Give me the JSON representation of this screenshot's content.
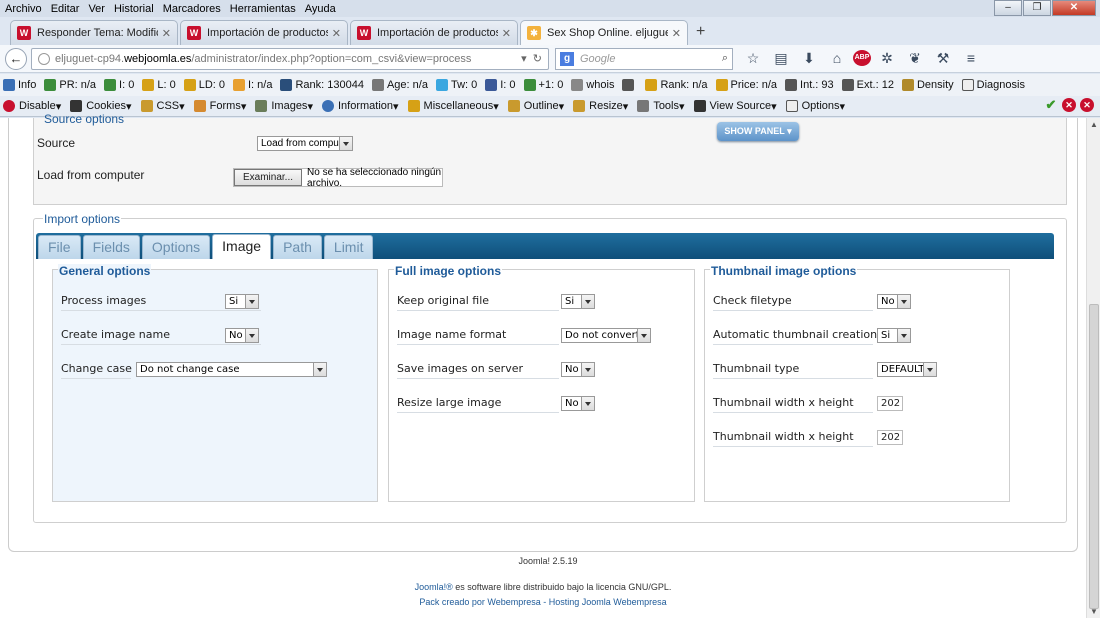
{
  "menubar": {
    "items": [
      "Archivo",
      "Editar",
      "Ver",
      "Historial",
      "Marcadores",
      "Herramientas",
      "Ayuda"
    ]
  },
  "browser_tabs": [
    {
      "title": "Responder Tema: Modifica...",
      "icon": "joomla-icon"
    },
    {
      "title": "Importación de productos ...",
      "icon": "joomla-icon"
    },
    {
      "title": "Importación de productos ...",
      "icon": "joomla-icon"
    },
    {
      "title": "Sex Shop Online. eljuguete...",
      "icon": "joomla-icon",
      "active": true
    }
  ],
  "urlbar": {
    "host_prefix": "eljuguet-cp94.",
    "host": "webjoomla.es",
    "path": "/administrator/index.php?option=com_csvi&view=process"
  },
  "searchbar": {
    "placeholder": "Google"
  },
  "seobar": {
    "items": [
      "Info",
      "PR: n/a",
      "I: 0",
      "L: 0",
      "LD: 0",
      "I: n/a",
      "Rank: 130044",
      "Age: n/a",
      "Tw: 0",
      "I: 0",
      "+1: 0",
      "whois",
      "Rank: n/a",
      "Price: n/a",
      "Int.: 93",
      "Ext.: 12",
      "Density",
      "Diagnosis"
    ]
  },
  "devbar": {
    "items": [
      "Disable",
      "Cookies",
      "CSS",
      "Forms",
      "Images",
      "Information",
      "Miscellaneous",
      "Outline",
      "Resize",
      "Tools",
      "View Source",
      "Options"
    ]
  },
  "source_options": {
    "legend": "Source options",
    "source_label": "Source",
    "source_value": "Load from computer",
    "load_label": "Load from computer",
    "browse_button": "Examinar...",
    "file_status": "No se ha seleccionado ningún archivo.",
    "show_panel": "SHOW PANEL"
  },
  "import_options": {
    "legend": "Import options",
    "tabs": [
      "File",
      "Fields",
      "Options",
      "Image",
      "Path",
      "Limit"
    ],
    "active_tab": "Image",
    "general": {
      "title": "General options",
      "process_images": {
        "label": "Process images",
        "value": "Si"
      },
      "create_image_name": {
        "label": "Create image name",
        "value": "No"
      },
      "change_case": {
        "label": "Change case",
        "value": "Do not change case"
      }
    },
    "full": {
      "title": "Full image options",
      "keep_original": {
        "label": "Keep original file",
        "value": "Si"
      },
      "name_format": {
        "label": "Image name format",
        "value": "Do not convert"
      },
      "save_on_server": {
        "label": "Save images on server",
        "value": "No"
      },
      "resize_large": {
        "label": "Resize large image",
        "value": "No"
      }
    },
    "thumbnail": {
      "title": "Thumbnail image options",
      "check_filetype": {
        "label": "Check filetype",
        "value": "No"
      },
      "auto_creation": {
        "label": "Automatic thumbnail creation",
        "value": "Si"
      },
      "type": {
        "label": "Thumbnail type",
        "value": "DEFAULT"
      },
      "width": {
        "label": "Thumbnail width x height",
        "value": "202"
      },
      "height": {
        "label": "Thumbnail width x height",
        "value": "202"
      }
    }
  },
  "footer": {
    "version": "Joomla! 2.5.19",
    "license_link": "Joomla!®",
    "license_text": " es software libre distribuido bajo la licencia GNU/GPL.",
    "pack_text": "Pack creado por Webempresa - Hosting Joomla Webempresa"
  }
}
